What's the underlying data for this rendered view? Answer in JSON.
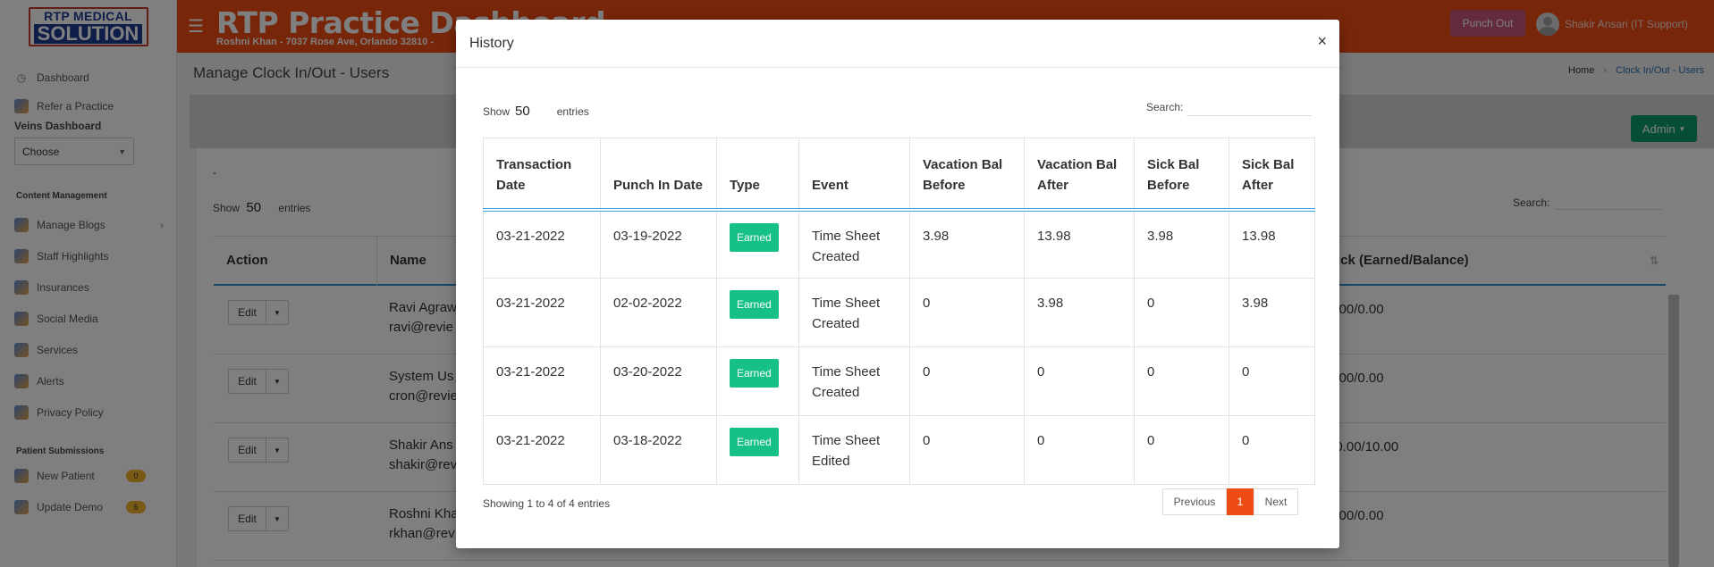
{
  "header": {
    "logo_line1": "RTP MEDICAL",
    "logo_line2": "SOLUTION",
    "title": "RTP Practice Dashboard",
    "subtitle": "Roshni Khan - 7037 Rose Ave, Orlando 32810 -",
    "punch_out": "Punch Out",
    "user": "Shakir Ansari (IT Support)"
  },
  "sidebar": {
    "dashboard": "Dashboard",
    "refer": "Refer a Practice",
    "veins_heading": "Veins Dashboard",
    "veins_select": "Choose",
    "content_section": "Content Management",
    "content_items": [
      "Manage Blogs",
      "Staff Highlights",
      "Insurances",
      "Social Media",
      "Services",
      "Alerts",
      "Privacy Policy"
    ],
    "patient_section": "Patient Submissions",
    "patient_items": [
      {
        "label": "New Patient",
        "count": "0"
      },
      {
        "label": "Update Demo",
        "count": "6"
      }
    ]
  },
  "page": {
    "title": "Manage Clock In/Out - Users",
    "breadcrumb_home": "Home",
    "breadcrumb_current": "Clock In/Out - Users",
    "admin_button": "Admin",
    "dot": "-",
    "show_label": "Show",
    "show_value": "50",
    "entries_label": "entries",
    "search_label": "Search:",
    "columns": {
      "action": "Action",
      "name": "Name",
      "sick": "Sick (Earned/Balance)"
    },
    "rows": [
      {
        "edit": "Edit",
        "name1": "Ravi Agraw",
        "name2": "ravi@revie",
        "sick": "0.00/0.00"
      },
      {
        "edit": "Edit",
        "name1": "System Us",
        "name2": "cron@revie",
        "sick": "0.00/0.00"
      },
      {
        "edit": "Edit",
        "name1": "Shakir Ans",
        "name2": "shakir@rev",
        "sick": "10.00/10.00"
      },
      {
        "edit": "Edit",
        "name1": "Roshni Kha",
        "name2": "rkhan@rev",
        "sick": "0.00/0.00"
      }
    ]
  },
  "modal": {
    "title": "History",
    "close": "×",
    "show_label": "Show",
    "show_value": "50",
    "entries_label": "entries",
    "search_label": "Search:",
    "columns": [
      "Transaction Date",
      "Punch In Date",
      "Type",
      "Event",
      "Vacation Bal Before",
      "Vacation Bal After",
      "Sick Bal Before",
      "Sick Bal After"
    ],
    "rows": [
      {
        "txn": "03-21-2022",
        "punch": "03-19-2022",
        "type": "Earned",
        "event": "Time Sheet Created",
        "vb": "3.98",
        "va": "13.98",
        "sb": "3.98",
        "sa": "13.98"
      },
      {
        "txn": "03-21-2022",
        "punch": "02-02-2022",
        "type": "Earned",
        "event": "Time Sheet Created",
        "vb": "0",
        "va": "3.98",
        "sb": "0",
        "sa": "3.98"
      },
      {
        "txn": "03-21-2022",
        "punch": "03-20-2022",
        "type": "Earned",
        "event": "Time Sheet Created",
        "vb": "0",
        "va": "0",
        "sb": "0",
        "sa": "0"
      },
      {
        "txn": "03-21-2022",
        "punch": "03-18-2022",
        "type": "Earned",
        "event": "Time Sheet Edited",
        "vb": "0",
        "va": "0",
        "sb": "0",
        "sa": "0"
      }
    ],
    "info": "Showing 1 to 4 of 4 entries",
    "prev": "Previous",
    "page": "1",
    "next": "Next"
  }
}
